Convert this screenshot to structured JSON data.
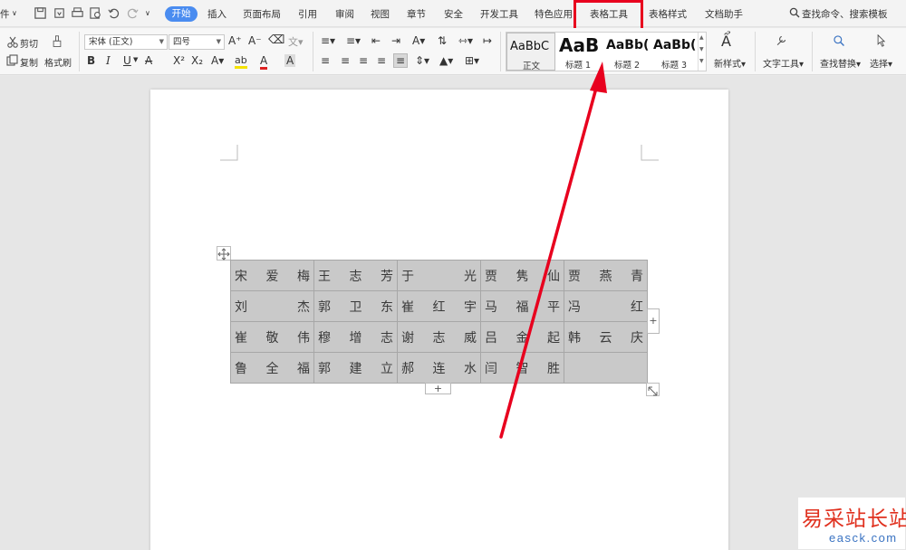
{
  "menu": {
    "file_partial": "件",
    "start": "开始",
    "tabs": [
      "插入",
      "页面布局",
      "引用",
      "审阅",
      "视图",
      "章节",
      "安全",
      "开发工具",
      "特色应用",
      "表格工具",
      "表格样式",
      "文档助手"
    ],
    "search": "查找命令、搜索模板"
  },
  "ribbon": {
    "cut": "剪切",
    "copy": "复制",
    "format_painter": "格式刷",
    "font_name": "宋体 (正文)",
    "font_size": "四号",
    "bold": "B",
    "italic": "I",
    "underline": "U",
    "styles": [
      {
        "sample": "AaBbC",
        "label": "正文"
      },
      {
        "sample": "AaB",
        "label": "标题 1"
      },
      {
        "sample": "AaBb(",
        "label": "标题 2"
      },
      {
        "sample": "AaBb(",
        "label": "标题 3"
      }
    ],
    "new_style": "新样式",
    "text_tools": "文字工具",
    "find_replace": "查找替换",
    "select": "选择"
  },
  "table": {
    "rows": [
      [
        [
          "宋",
          "爱",
          "梅"
        ],
        [
          "王",
          "志",
          "芳"
        ],
        [
          "于",
          "",
          "光"
        ],
        [
          "贾",
          "隽",
          "仙"
        ],
        [
          "贾",
          "燕",
          "青"
        ]
      ],
      [
        [
          "刘",
          "",
          "杰"
        ],
        [
          "郭",
          "卫",
          "东"
        ],
        [
          "崔",
          "红",
          "宇"
        ],
        [
          "马",
          "福",
          "平"
        ],
        [
          "冯",
          "",
          "红"
        ]
      ],
      [
        [
          "崔",
          "敬",
          "伟"
        ],
        [
          "穆",
          "增",
          "志"
        ],
        [
          "谢",
          "志",
          "威"
        ],
        [
          "吕",
          "金",
          "起"
        ],
        [
          "韩",
          "云",
          "庆"
        ]
      ],
      [
        [
          "鲁",
          "全",
          "福"
        ],
        [
          "郭",
          "建",
          "立"
        ],
        [
          "郝",
          "连",
          "水"
        ],
        [
          "闫",
          "智",
          "胜"
        ],
        [
          "",
          "",
          ""
        ]
      ]
    ]
  },
  "add_symbol": "+",
  "watermark": {
    "cn": "易采站长站",
    "en": "easck.com"
  },
  "colors": {
    "accent": "#4a8cf0",
    "highlight": "#e8001e",
    "cell_bg": "#c9c9c9"
  }
}
